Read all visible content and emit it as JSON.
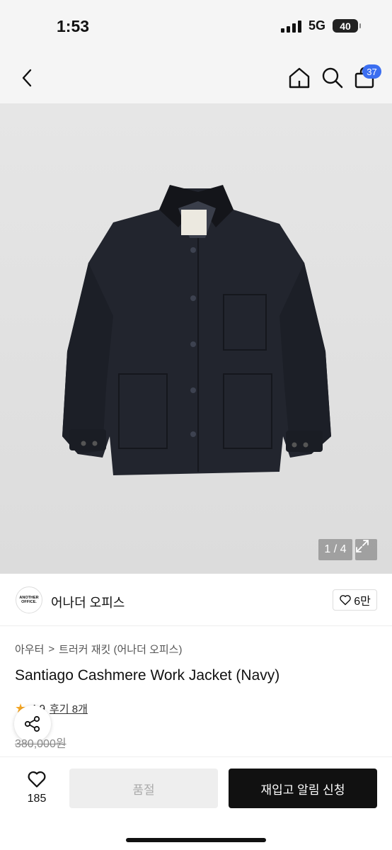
{
  "status": {
    "time": "1:53",
    "network": "5G",
    "battery": "40"
  },
  "nav": {
    "cart_count": "37"
  },
  "gallery": {
    "counter": "1 / 4"
  },
  "brand": {
    "logo_line1": "ANOTHER",
    "logo_line2": "OFFICE.",
    "name": "어나더 오피스",
    "likes": "6만"
  },
  "breadcrumb": {
    "level1": "아우터",
    "separator": ">",
    "level2": "트러커 재킷 (어나더 오피스)"
  },
  "product": {
    "title": "Santiago Cashmere Work Jacket (Navy)",
    "rating": "4.9",
    "reviews": "후기 8개",
    "original_price": "380,000원"
  },
  "bottom": {
    "wish_count": "185",
    "soldout_label": "품절",
    "restock_label": "재입고 알림 신청"
  },
  "colors": {
    "accent": "#3b6ef0",
    "dark": "#111111",
    "star": "#f5a623"
  },
  "icons": [
    "chevron-left-icon",
    "home-icon",
    "search-icon",
    "bag-icon",
    "expand-icon",
    "heart-icon",
    "share-icon",
    "star-icon"
  ]
}
